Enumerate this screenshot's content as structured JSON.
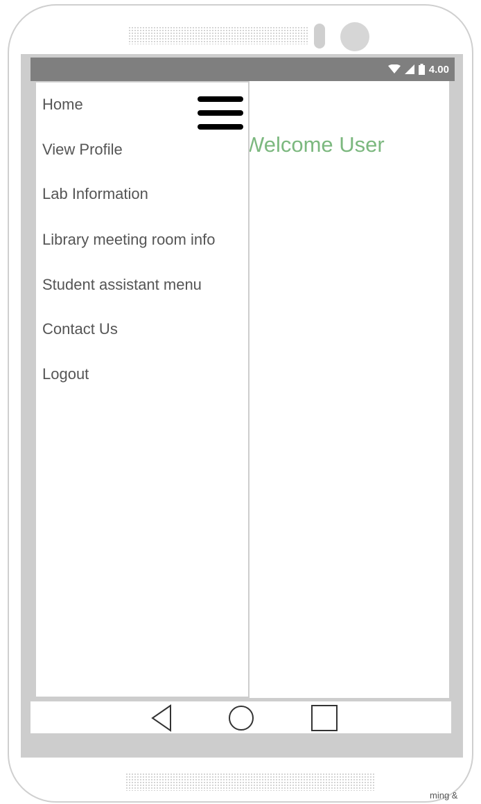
{
  "status_bar": {
    "time": "4.00",
    "icons": [
      "wifi-icon",
      "signal-icon",
      "battery-icon"
    ]
  },
  "main": {
    "welcome_text": "Welcome User"
  },
  "drawer": {
    "items": [
      {
        "label": "Home"
      },
      {
        "label": "View Profile"
      },
      {
        "label": "Lab Information"
      },
      {
        "label": "Library meeting room info"
      },
      {
        "label": "Student assistant menu"
      },
      {
        "label": "Contact Us"
      },
      {
        "label": "Logout"
      }
    ]
  },
  "nav_bar": {
    "buttons": [
      "back-icon",
      "home-icon",
      "recents-icon"
    ]
  },
  "footer": {
    "credit_fragment": "ming &"
  },
  "colors": {
    "status_bar": "#7f7f7f",
    "welcome_text": "#7cb87f",
    "menu_text": "#555555",
    "frame": "#cdcdcd"
  }
}
